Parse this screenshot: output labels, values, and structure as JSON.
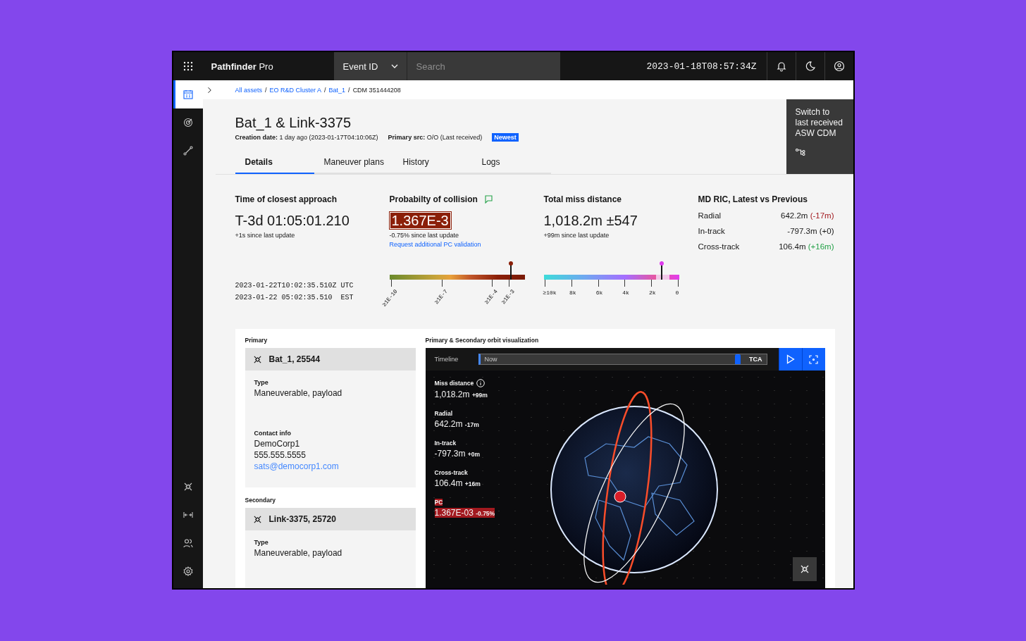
{
  "header": {
    "brand": "Pathfinder",
    "product": "Pro",
    "scope": "Event ID",
    "search_placeholder": "Search",
    "timestamp": "2023-01-18T08:57:34Z"
  },
  "rail": [
    {
      "selected": true
    },
    {
      "selected": false
    },
    {
      "selected": false
    }
  ],
  "breadcrumb": [
    {
      "label": "All assets",
      "link": true
    },
    {
      "label": "EO R&D Cluster A",
      "link": true
    },
    {
      "label": "Bat_1",
      "link": true
    },
    {
      "label": "CDM 351444208",
      "link": false
    }
  ],
  "breadcrumb_separator": "/",
  "title": "Bat_1 & Link-3375",
  "meta": [
    {
      "label": "Creation date:",
      "value": "1 day ago (2023-01-17T04:10:06Z)"
    },
    {
      "label": "Primary src:",
      "value": "O/O (Last received)"
    }
  ],
  "badge": "Newest",
  "switch_button": "Switch to last received ASW CDM",
  "tabs": [
    {
      "label": "Details",
      "selected": true
    },
    {
      "label": "Maneuver plans",
      "selected": false
    },
    {
      "label": "History",
      "selected": false
    },
    {
      "label": "Logs",
      "selected": false
    }
  ],
  "tca": {
    "title": "Time of closest approach",
    "value": "T-3d 01:05:01.210",
    "delta": "+1s since last update",
    "times": [
      "2023-01-22T10:02:35.510Z UTC",
      "2023-01-22 05:02:35.510  EST"
    ]
  },
  "pc": {
    "title": "Probabilty of collision",
    "value": "1.367E-3",
    "delta": "-0.75% since last update",
    "link": "Request additional PC validation",
    "gauge": {
      "level": 0.9,
      "ticks": [
        "≥1E-10",
        "≥1E-7",
        "≥1E-4",
        "≥1E-3"
      ]
    }
  },
  "miss": {
    "title": "Total miss distance",
    "value": "1,018.2m ±547",
    "delta": "+99m since last update",
    "gauge": {
      "level": 0.87,
      "ticks": [
        "≥10k",
        "8k",
        "6k",
        "4k",
        "2k",
        "0"
      ]
    }
  },
  "ric": {
    "title": "MD RIC, Latest vs Previous",
    "rows": [
      {
        "label": "Radial",
        "value": "642.2m",
        "change": "(-17m)",
        "color": "#a2191f"
      },
      {
        "label": "In-track",
        "value": "-797.3m",
        "change": "(+0)",
        "color": "#161616"
      },
      {
        "label": "Cross-track",
        "value": "106.4m",
        "change": "(+16m)",
        "color": "#24a148"
      }
    ]
  },
  "objects": [
    {
      "section": "Primary",
      "name": "Bat_1, 25544",
      "fields": [
        {
          "label": "Type",
          "lines": [
            "Maneuverable, payload"
          ]
        },
        {
          "label": "Contact info",
          "lines": [
            "DemoCorp1",
            "555.555.5555"
          ],
          "email": "sats@democorp1.com"
        }
      ]
    },
    {
      "section": "Secondary",
      "name": "Link-3375, 25720",
      "fields": [
        {
          "label": "Type",
          "lines": [
            "Maneuverable, payload"
          ]
        }
      ]
    }
  ],
  "viz": {
    "title": "Primary & Secondary orbit visualization",
    "timeline": {
      "label": "Timeline",
      "start": "Now",
      "end": "TCA",
      "level": 0.9
    },
    "stats": [
      {
        "label": "Miss distance",
        "value": "1,018.2m",
        "delta": "+99m",
        "info": true,
        "alert": false
      },
      {
        "label": "Radial",
        "value": "642.2m",
        "delta": "-17m",
        "info": false,
        "alert": false
      },
      {
        "label": "In-track",
        "value": "-797.3m",
        "delta": "+0m",
        "info": false,
        "alert": false
      },
      {
        "label": "Cross-track",
        "value": "106.4m",
        "delta": "+16m",
        "info": false,
        "alert": false
      },
      {
        "label": "PC",
        "value": "1.367E-03",
        "delta": "-0.75%",
        "info": false,
        "alert": true
      }
    ]
  }
}
